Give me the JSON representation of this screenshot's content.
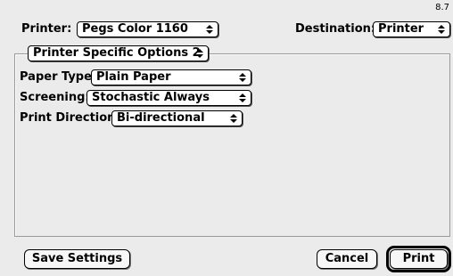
{
  "version": "8.7",
  "printer": {
    "label": "Printer:",
    "value": "Pegs Color 1160"
  },
  "destination": {
    "label": "Destination:",
    "value": "Printer"
  },
  "panel_selector": {
    "value": "Printer Specific Options 2"
  },
  "options": {
    "paper_type": {
      "label": "Paper Type:",
      "value": "Plain Paper"
    },
    "screening": {
      "label": "Screening:",
      "value": "Stochastic Always"
    },
    "print_direction": {
      "label": "Print Direction:",
      "value": "Bi-directional"
    }
  },
  "buttons": {
    "save_settings": "Save Settings",
    "cancel": "Cancel",
    "print": "Print"
  },
  "icons": {
    "popup_arrows": "updown-arrows-icon"
  }
}
